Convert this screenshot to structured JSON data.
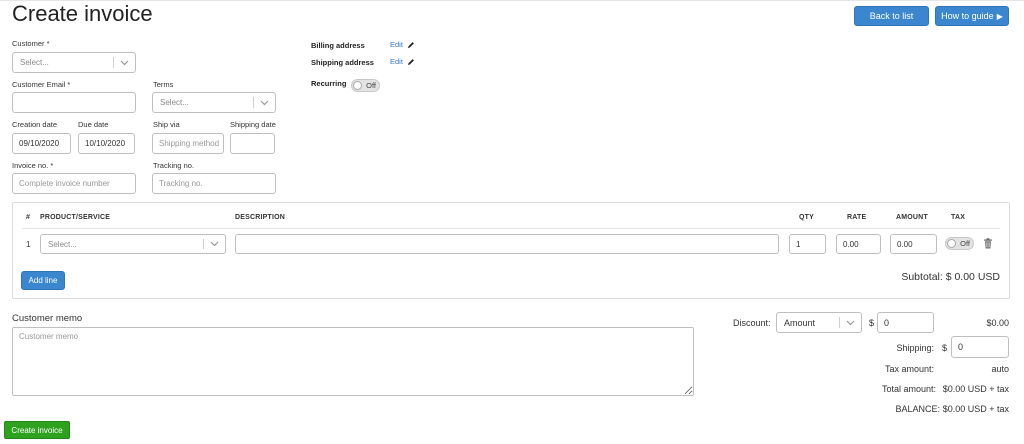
{
  "header": {
    "title": "Create invoice",
    "back_to_list": "Back to list",
    "how_to_guide": "How to guide",
    "how_to_guide_arrow": "▶"
  },
  "form": {
    "customer": {
      "label": "Customer *",
      "placeholder": "Select..."
    },
    "customer_email": {
      "label": "Customer Email *",
      "value": ""
    },
    "terms": {
      "label": "Terms",
      "placeholder": "Select..."
    },
    "creation_date": {
      "label": "Creation date",
      "value": "09/10/2020"
    },
    "due_date": {
      "label": "Due date",
      "value": "10/10/2020"
    },
    "ship_via": {
      "label": "Ship via",
      "placeholder": "Shipping method"
    },
    "shipping_date": {
      "label": "Shipping date",
      "value": ""
    },
    "invoice_no": {
      "label": "Invoice no. *",
      "placeholder": "Complete invoice number"
    },
    "tracking_no": {
      "label": "Tracking no.",
      "placeholder": "Tracking no."
    },
    "billing_address": {
      "label": "Billing address",
      "edit": "Edit"
    },
    "shipping_address": {
      "label": "Shipping address",
      "edit": "Edit"
    },
    "recurring": {
      "label": "Recurring",
      "state": "Off"
    }
  },
  "lines": {
    "headers": {
      "num": "#",
      "product": "PRODUCT/SERVICE",
      "description": "DESCRIPTION",
      "qty": "QTY",
      "rate": "RATE",
      "amount": "AMOUNT",
      "tax": "TAX"
    },
    "rows": [
      {
        "num": "1",
        "product_placeholder": "Select...",
        "description": "",
        "qty": "1",
        "rate": "0.00",
        "amount": "0.00",
        "tax": "Off"
      }
    ],
    "add_line": "Add line",
    "subtotal": "Subtotal: $ 0.00 USD"
  },
  "memo": {
    "label": "Customer memo",
    "placeholder": "Customer memo"
  },
  "totals": {
    "discount_label": "Discount:",
    "discount_type": "Amount",
    "discount_currency": "$",
    "discount_value": "0",
    "discount_result": "$0.00",
    "shipping_label": "Shipping:",
    "shipping_currency": "$",
    "shipping_value": "0",
    "tax_amount_label": "Tax amount:",
    "tax_amount_value": "auto",
    "total_amount_label": "Total amount:",
    "total_amount_value": "$0.00 USD + tax",
    "balance_label": "BALANCE:",
    "balance_value": "$0.00 USD + tax"
  },
  "footer": {
    "create_invoice": "Create invoice"
  },
  "colors": {
    "primary": "#3a87cf",
    "success": "#2ea21f",
    "link": "#3a78c3"
  }
}
